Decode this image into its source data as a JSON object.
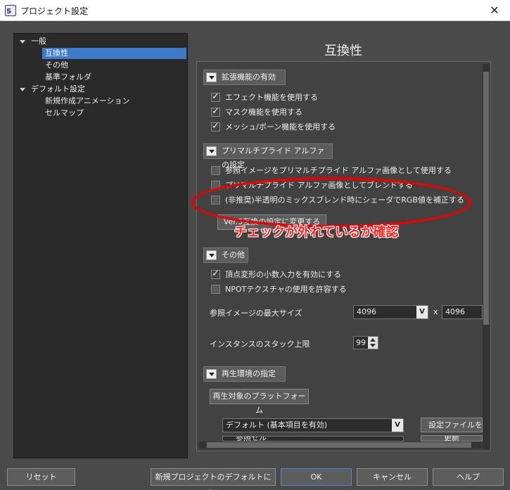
{
  "window": {
    "title": "プロジェクト設定",
    "close": "✕"
  },
  "tree": {
    "general": "一般",
    "compat": "互換性",
    "other": "その他",
    "base_folder": "基準フォルダ",
    "default_settings": "デフォルト設定",
    "new_animation": "新規作成アニメーション",
    "cellmap": "セルマップ"
  },
  "panel": {
    "title": "互換性",
    "sections": {
      "ext": {
        "title": "拡張機能の有効",
        "items": [
          {
            "label": "エフェクト機能を使用する",
            "checked": true
          },
          {
            "label": "マスク機能を使用する",
            "checked": true
          },
          {
            "label": "メッシュ/ボーン機能を使用する",
            "checked": true
          }
        ]
      },
      "premul": {
        "title": "プリマルチプライド アルファの設定",
        "items": [
          {
            "label": "参照イメージをプリマルチプライド アルファ画像として使用する",
            "checked": false
          },
          {
            "label": "プリマルチプライド アルファ画像としてブレンドする",
            "checked": false
          },
          {
            "label": "(非推奨)半透明のミックスブレンド時にシェーダでRGB値を補正する",
            "checked": false
          }
        ],
        "ver5_button": "Ver.5互換の設定に変更する"
      },
      "misc": {
        "title": "その他",
        "items": [
          {
            "label": "頂点変形の小数入力を有効にする",
            "checked": true
          },
          {
            "label": "NPOTテクスチャの使用を許容する",
            "checked": false
          }
        ],
        "max_size_label": "参照イメージの最大サイズ",
        "max_size_w": "4096",
        "times": "x",
        "max_size_h": "4096",
        "stack_label": "インスタンスのスタック上限",
        "stack_value": "99"
      },
      "playback": {
        "title": "再生環境の指定",
        "target_tab": "再生対象のプラットフォーム",
        "platform": "デフォルト (基本項目を有効)",
        "config_button": "設定ファイルを開",
        "update_button": "更新",
        "cut_item": "参照セル"
      }
    }
  },
  "annotation": {
    "text": "チェックが外れているか確認",
    "color": "#ff2424"
  },
  "footer": {
    "reset": "リセット",
    "make_default": "新規プロジェクトのデフォルトにする",
    "ok": "OK",
    "cancel": "キャンセル",
    "help": "ヘルプ"
  }
}
